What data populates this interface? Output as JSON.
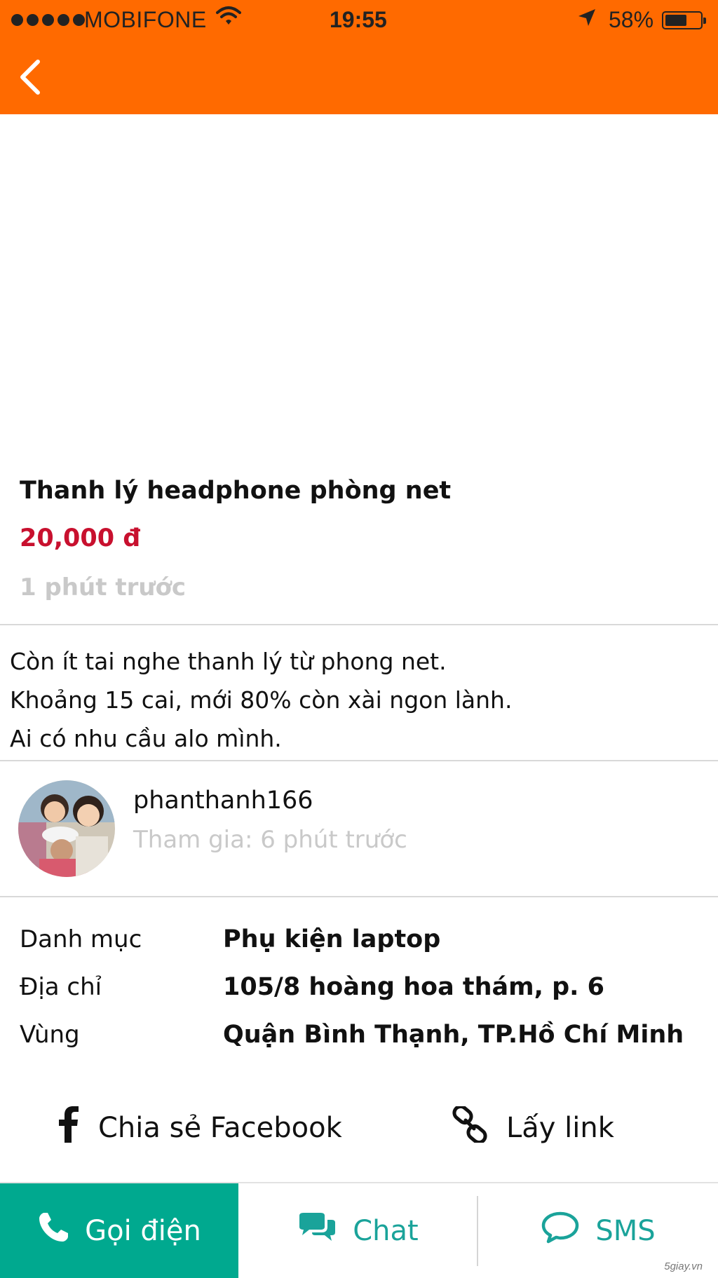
{
  "status_bar": {
    "carrier": "MOBIFONE",
    "time": "19:55",
    "battery": "58%",
    "battery_level": 0.58,
    "signal_bars": 5
  },
  "header": {
    "color": "#ff6a00",
    "back_icon": "chevron-left-icon"
  },
  "listing": {
    "title": "Thanh lý headphone phòng net",
    "price": "20,000 đ",
    "posted": "1 phút trước",
    "price_color": "#c8102e",
    "description": [
      "Còn ít tai nghe thanh lý từ phong net.",
      "Khoảng 15 cai, mới 80% còn xài ngon lành.",
      "Ai có nhu cầu alo mình."
    ]
  },
  "seller": {
    "username": "phanthanh166",
    "joined": "Tham gia: 6 phút trước",
    "avatar_icon": "avatar-photo"
  },
  "details": [
    {
      "label": "Danh mục",
      "value": "Phụ kiện laptop"
    },
    {
      "label": "Địa chỉ",
      "value": "105/8 hoàng hoa thám, p. 6"
    },
    {
      "label": "Vùng",
      "value": "Quận Bình Thạnh, TP.Hồ Chí Minh"
    }
  ],
  "share": {
    "facebook": "Chia sẻ Facebook",
    "link": "Lấy link"
  },
  "actions": {
    "call": "Gọi điện",
    "chat": "Chat",
    "sms": "SMS",
    "accent": "#00a98f"
  },
  "watermark": "5giay.vn"
}
